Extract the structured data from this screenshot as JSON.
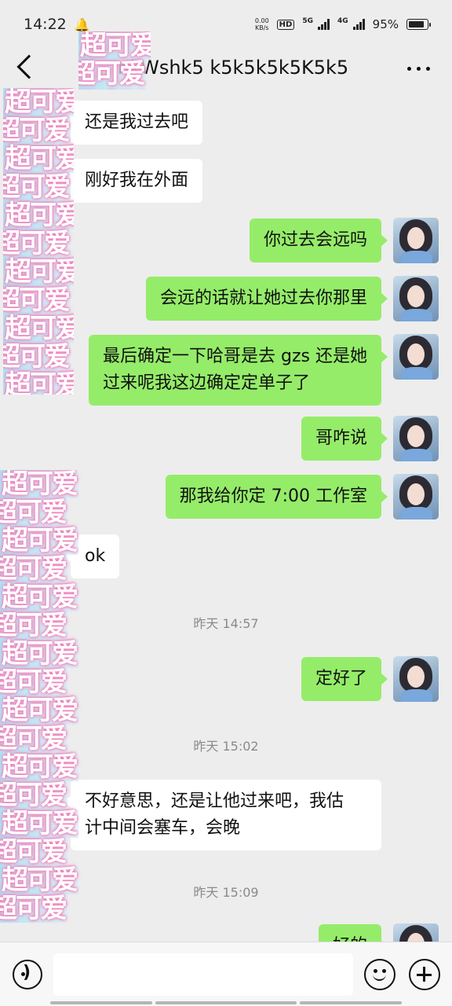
{
  "status_bar": {
    "time": "14:22",
    "speed_value": "0.00",
    "speed_unit": "KB/s",
    "hd_label": "HD",
    "network_1": "5G",
    "network_2": "4G",
    "battery": "95%"
  },
  "nav": {
    "title": "nkWshk5 k5k5k5k5K5k5"
  },
  "messages": [
    {
      "side": "in",
      "text": "还是我过去吧"
    },
    {
      "side": "in",
      "text": "刚好我在外面"
    },
    {
      "side": "out",
      "text": "你过去会远吗"
    },
    {
      "side": "out",
      "text": "会远的话就让她过去你那里"
    },
    {
      "side": "out",
      "text": "最后确定一下哈哥是去 gzs 还是她\n过来呢我这边确定定单子了"
    },
    {
      "side": "out",
      "text": "哥咋说"
    },
    {
      "side": "out",
      "text": "那我给你定 7:00 工作室"
    },
    {
      "side": "in",
      "text": "ok"
    },
    {
      "side": "out",
      "text": "定好了"
    },
    {
      "side": "in",
      "text": "不好意思，还是让他过来吧，我估\n计中间会塞车，会晚"
    },
    {
      "side": "out",
      "text": "好的"
    }
  ],
  "timestamps": [
    "昨天 14:57",
    "昨天 15:02",
    "昨天 15:09"
  ],
  "sticker_text": "超可爱",
  "input": {
    "placeholder": ""
  },
  "colors": {
    "outgoing_bubble": "#95ec69",
    "incoming_bubble": "#ffffff",
    "background": "#ededed"
  }
}
